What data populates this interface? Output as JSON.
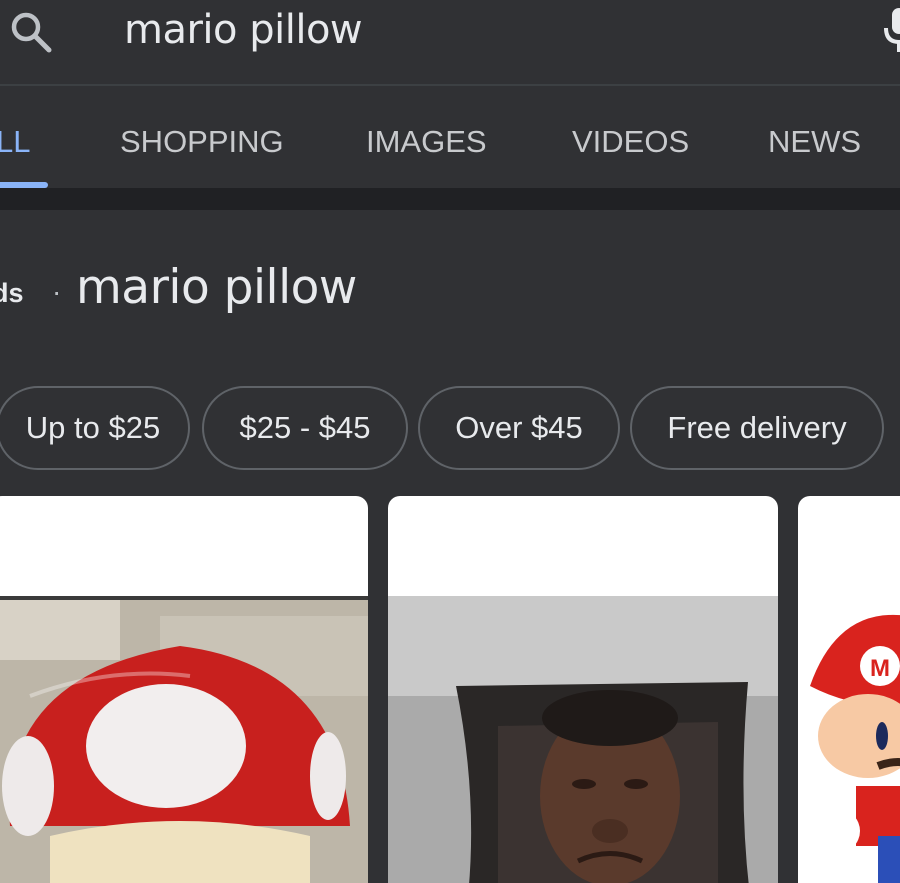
{
  "search": {
    "query": "mario pillow",
    "search_icon": "search-icon",
    "mic_icon": "mic-icon"
  },
  "tabs": [
    {
      "label": "LL",
      "active": true
    },
    {
      "label": "SHOPPING",
      "active": false
    },
    {
      "label": "IMAGES",
      "active": false
    },
    {
      "label": "VIDEOS",
      "active": false
    },
    {
      "label": "NEWS",
      "active": false
    }
  ],
  "ads": {
    "label": "ds",
    "separator": "·",
    "title": "mario pillow"
  },
  "chips": [
    {
      "label": "Up to $25"
    },
    {
      "label": "$25 - $45"
    },
    {
      "label": "Over $45"
    },
    {
      "label": "Free delivery"
    }
  ],
  "products": [
    {
      "image": "mushroom-pillow-image"
    },
    {
      "image": "face-pillow-image"
    },
    {
      "image": "mario-plush-image"
    }
  ],
  "colors": {
    "background": "#303134",
    "accent": "#8ab4f8",
    "chip_border": "#5f6368"
  }
}
